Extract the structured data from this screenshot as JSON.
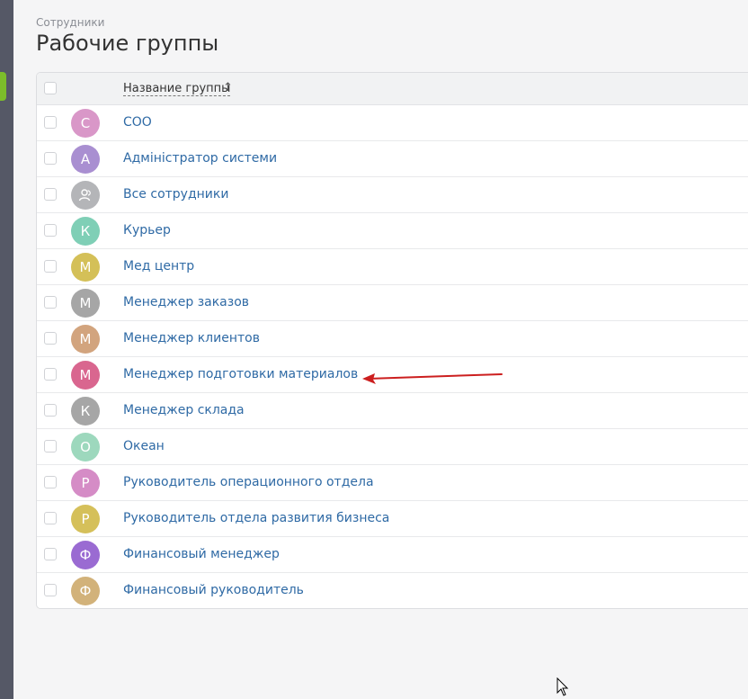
{
  "header": {
    "breadcrumb": "Сотрудники",
    "title": "Рабочие группы"
  },
  "table": {
    "column_name": "Название группы",
    "sort_icon": "↑",
    "rows": [
      {
        "initial": "С",
        "name": "СОО",
        "color": "#d997c8"
      },
      {
        "initial": "А",
        "name": "Адміністратор системи",
        "color": "#a98fd1"
      },
      {
        "initial": "",
        "name": "Все сотрудники",
        "color": "#b4b5b8",
        "icon": "user-group-icon"
      },
      {
        "initial": "К",
        "name": "Курьер",
        "color": "#7fcfb6"
      },
      {
        "initial": "М",
        "name": "Мед центр",
        "color": "#d4c058"
      },
      {
        "initial": "М",
        "name": "Менеджер заказов",
        "color": "#a6a6a6"
      },
      {
        "initial": "М",
        "name": "Менеджер клиентов",
        "color": "#d2a47e"
      },
      {
        "initial": "М",
        "name": "Менеджер подготовки материалов",
        "color": "#d9668f"
      },
      {
        "initial": "К",
        "name": "Менеджер склада",
        "color": "#a6a6a6"
      },
      {
        "initial": "О",
        "name": "Океан",
        "color": "#9dd8bd"
      },
      {
        "initial": "Р",
        "name": "Руководитель операционного отдела",
        "color": "#d58cc6"
      },
      {
        "initial": "Р",
        "name": "Руководитель отдела развития бизнеса",
        "color": "#d5c05a"
      },
      {
        "initial": "Ф",
        "name": "Финансовый менеджер",
        "color": "#9a6bd2"
      },
      {
        "initial": "Ф",
        "name": "Финансовый руководитель",
        "color": "#d2b27a"
      }
    ]
  },
  "colors": {
    "link": "#2f6aa5",
    "annotation_arrow": "#cc1f1f",
    "sidebar": "#555866",
    "sidebar_accent": "#7cbd2a"
  }
}
